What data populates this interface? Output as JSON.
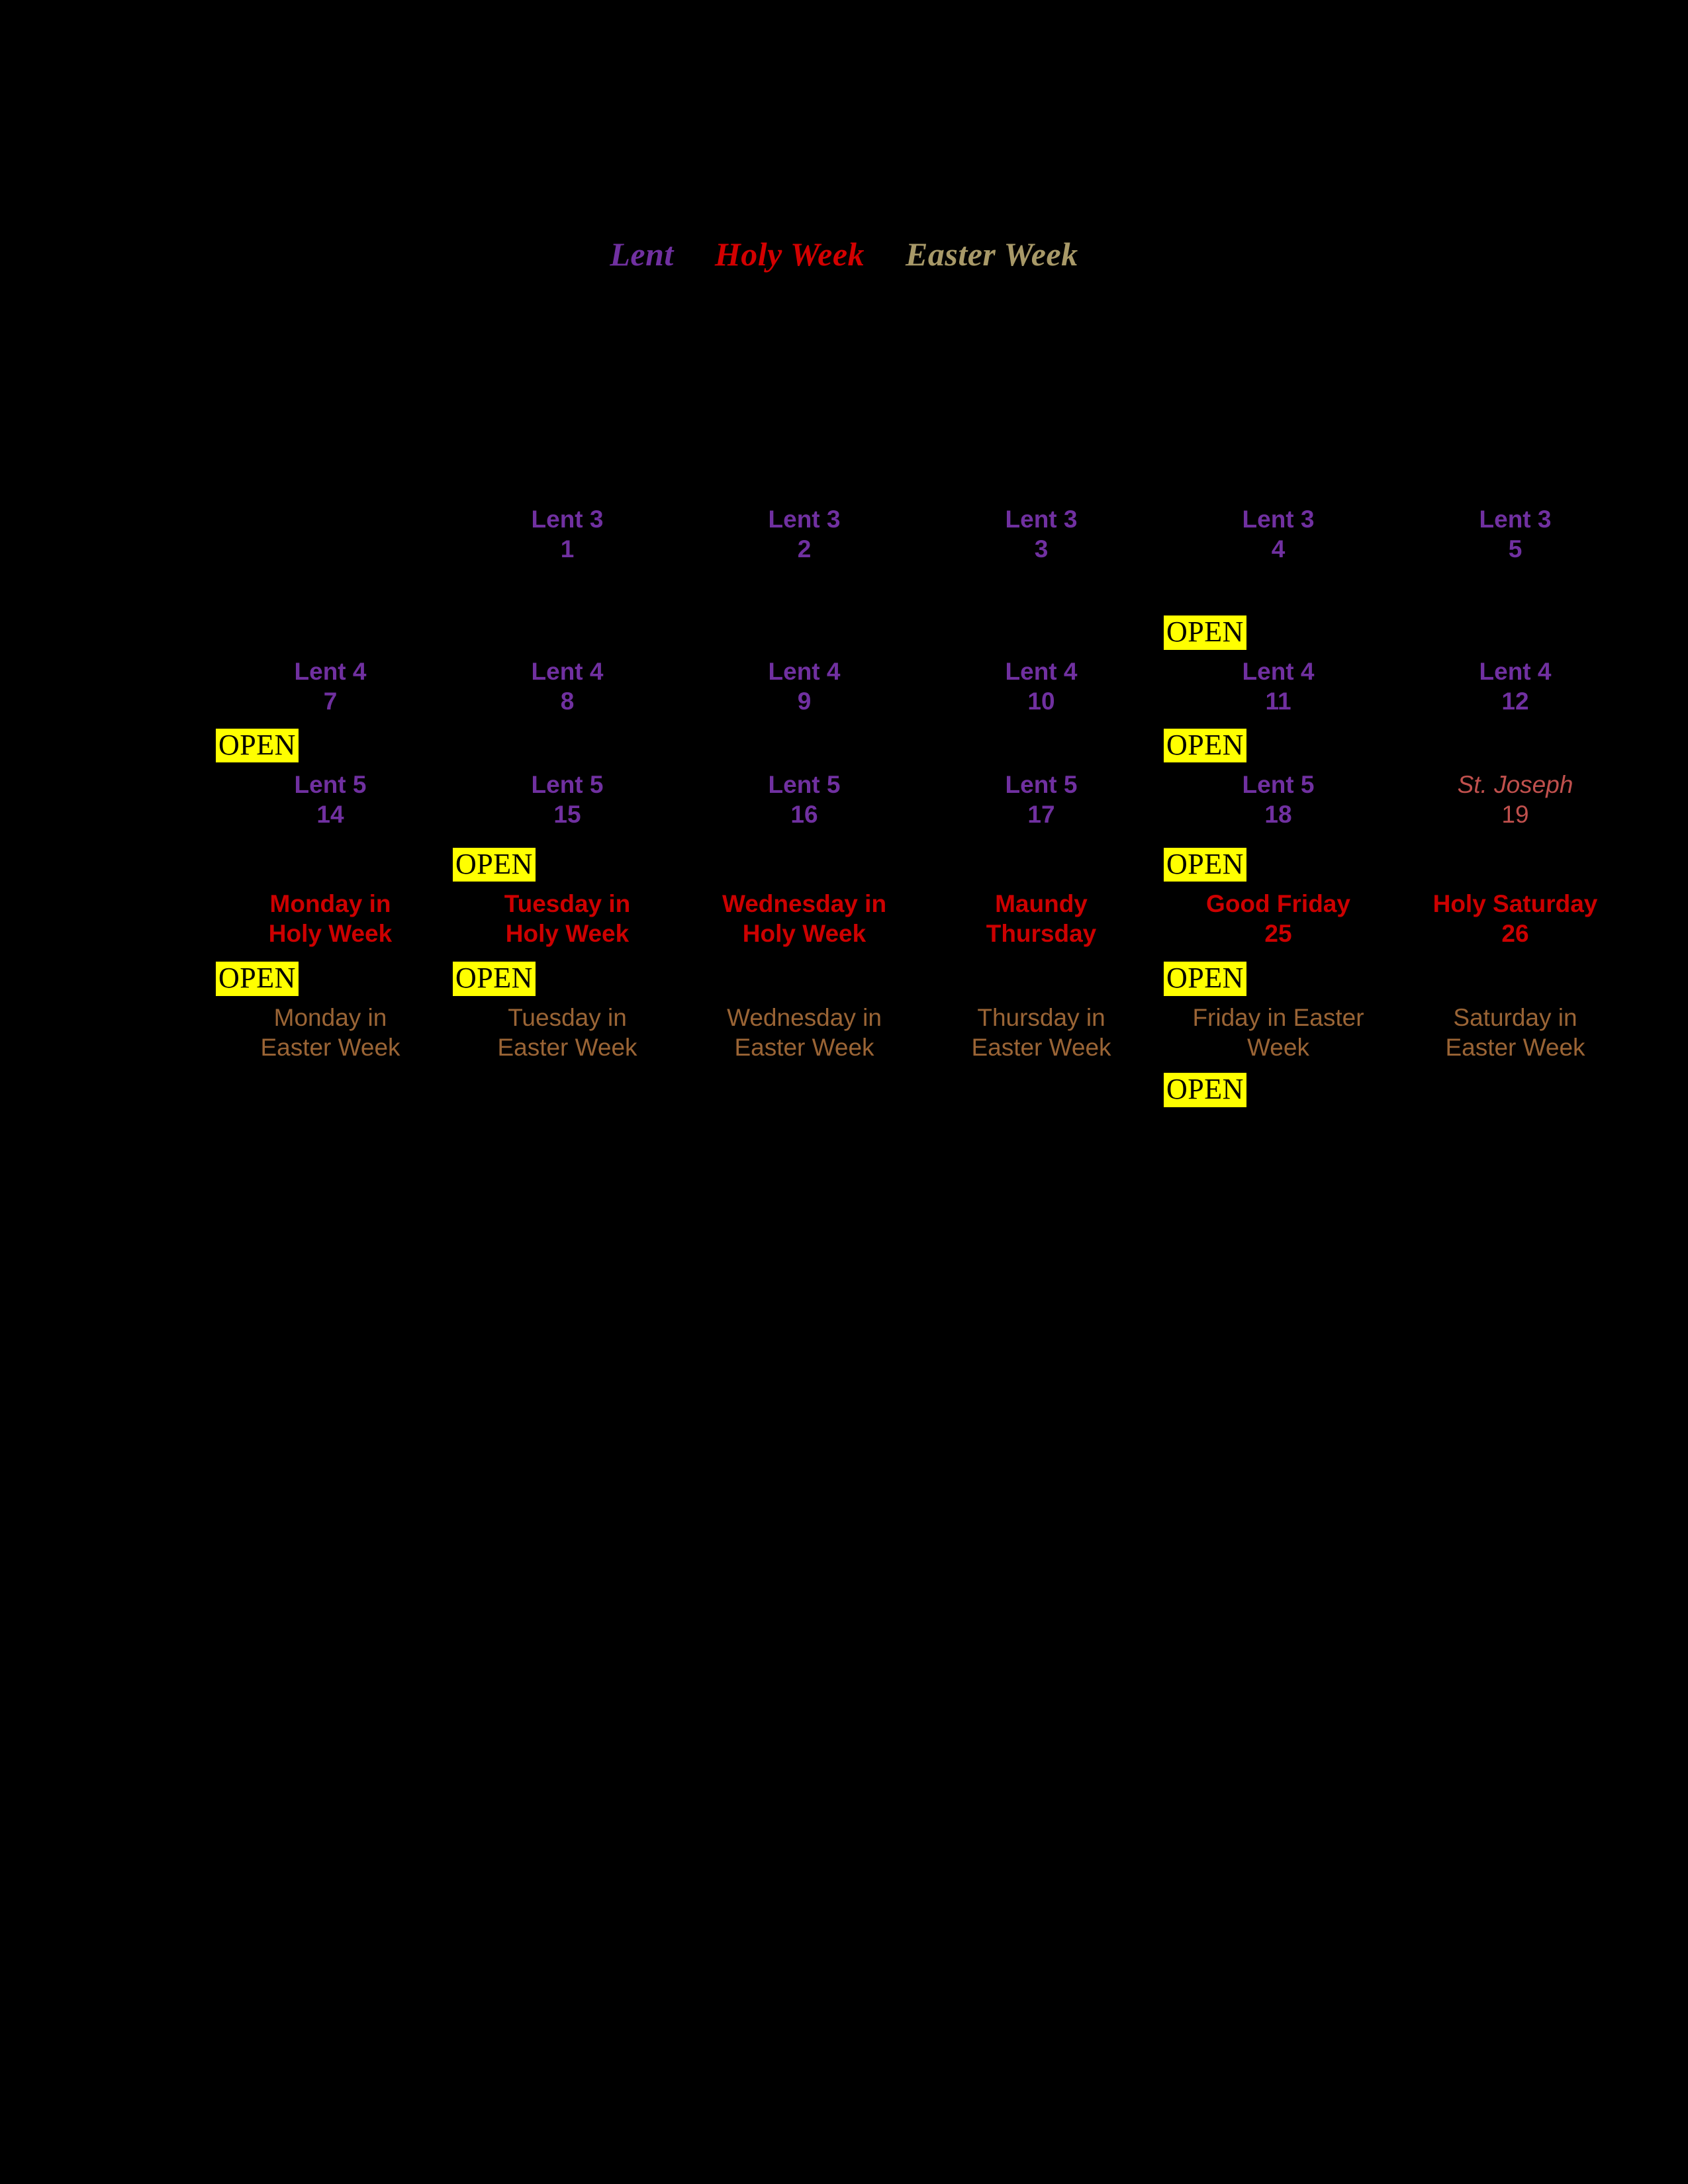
{
  "legend": {
    "items": [
      {
        "label": "Lent",
        "color": "#7030A0",
        "name": "legend-lent"
      },
      {
        "label": "Holy Week",
        "color": "#D30000",
        "name": "legend-holy-week"
      },
      {
        "label": "Easter Week",
        "color": "#A89968",
        "name": "legend-easter-week"
      }
    ]
  },
  "badges": {
    "open_label": "OPEN"
  },
  "colors": {
    "background": "#000000",
    "lent": "#7030A0",
    "holy_week": "#CC0000",
    "easter_week": "#9A6435",
    "feast": "#C0504D",
    "legend_easter_week": "#A89968",
    "badge_background": "#FFFF00",
    "badge_text": "#000000"
  },
  "calendar": {
    "columns": 6,
    "rows": [
      {
        "name": "row-lent-3",
        "cells": [
          {
            "empty": true,
            "season": "lent",
            "title": "",
            "date": "",
            "open": false
          },
          {
            "empty": false,
            "season": "lent",
            "title": "Lent 3",
            "date": "1",
            "open": false
          },
          {
            "empty": false,
            "season": "lent",
            "title": "Lent 3",
            "date": "2",
            "open": false
          },
          {
            "empty": false,
            "season": "lent",
            "title": "Lent 3",
            "date": "3",
            "open": false
          },
          {
            "empty": false,
            "season": "lent",
            "title": "Lent 3",
            "date": "4",
            "open": false
          },
          {
            "empty": false,
            "season": "lent",
            "title": "Lent 3",
            "date": "5",
            "open": false
          }
        ]
      },
      {
        "name": "row-lent-4",
        "cells": [
          {
            "empty": false,
            "season": "lent",
            "title": "Lent 4",
            "date": "7",
            "open": false
          },
          {
            "empty": false,
            "season": "lent",
            "title": "Lent 4",
            "date": "8",
            "open": false
          },
          {
            "empty": false,
            "season": "lent",
            "title": "Lent 4",
            "date": "9",
            "open": false
          },
          {
            "empty": false,
            "season": "lent",
            "title": "Lent 4",
            "date": "10",
            "open": false
          },
          {
            "empty": false,
            "season": "lent",
            "title": "Lent 4",
            "date": "11",
            "open": true
          },
          {
            "empty": false,
            "season": "lent",
            "title": "Lent 4",
            "date": "12",
            "open": false
          }
        ]
      },
      {
        "name": "row-lent-5",
        "cells": [
          {
            "empty": false,
            "season": "lent",
            "title": "Lent 5",
            "date": "14",
            "open": true
          },
          {
            "empty": false,
            "season": "lent",
            "title": "Lent 5",
            "date": "15",
            "open": false
          },
          {
            "empty": false,
            "season": "lent",
            "title": "Lent 5",
            "date": "16",
            "open": false
          },
          {
            "empty": false,
            "season": "lent",
            "title": "Lent 5",
            "date": "17",
            "open": false
          },
          {
            "empty": false,
            "season": "lent",
            "title": "Lent 5",
            "date": "18",
            "open": true
          },
          {
            "empty": false,
            "season": "feast",
            "title": "St. Joseph",
            "date": "19",
            "open": false
          }
        ]
      },
      {
        "name": "row-holy-week",
        "cells": [
          {
            "empty": false,
            "season": "holy",
            "title": "Monday in\nHoly Week",
            "date": "",
            "open": false
          },
          {
            "empty": false,
            "season": "holy",
            "title": "Tuesday in\nHoly Week",
            "date": "",
            "open": true
          },
          {
            "empty": false,
            "season": "holy",
            "title": "Wednesday in\nHoly Week",
            "date": "",
            "open": false
          },
          {
            "empty": false,
            "season": "holy",
            "title": "Maundy\nThursday",
            "date": "",
            "open": false
          },
          {
            "empty": false,
            "season": "holy",
            "title": "Good Friday",
            "date": "25",
            "open": true
          },
          {
            "empty": false,
            "season": "holy",
            "title": "Holy Saturday",
            "date": "26",
            "open": false
          }
        ]
      },
      {
        "name": "row-easter-week",
        "cells": [
          {
            "empty": false,
            "season": "easter",
            "title": "Monday in\nEaster Week",
            "date": "",
            "open": true
          },
          {
            "empty": false,
            "season": "easter",
            "title": "Tuesday in\nEaster Week",
            "date": "",
            "open": true
          },
          {
            "empty": false,
            "season": "easter",
            "title": "Wednesday in\nEaster Week",
            "date": "",
            "open": false
          },
          {
            "empty": false,
            "season": "easter",
            "title": "Thursday in\nEaster Week",
            "date": "",
            "open": false
          },
          {
            "empty": false,
            "season": "easter",
            "title": "Friday in Easter\nWeek",
            "date": "",
            "open": true
          },
          {
            "empty": false,
            "season": "easter",
            "title": "Saturday in\nEaster Week",
            "date": "",
            "open": false
          }
        ]
      },
      {
        "name": "row-trailing",
        "cells": [
          {
            "empty": true,
            "season": "lent",
            "title": "",
            "date": "",
            "open": false
          },
          {
            "empty": true,
            "season": "lent",
            "title": "",
            "date": "",
            "open": false
          },
          {
            "empty": true,
            "season": "lent",
            "title": "",
            "date": "",
            "open": false
          },
          {
            "empty": true,
            "season": "lent",
            "title": "",
            "date": "",
            "open": false
          },
          {
            "empty": true,
            "season": "lent",
            "title": "",
            "date": "",
            "open": true
          },
          {
            "empty": true,
            "season": "lent",
            "title": "",
            "date": "",
            "open": false
          }
        ]
      }
    ]
  }
}
